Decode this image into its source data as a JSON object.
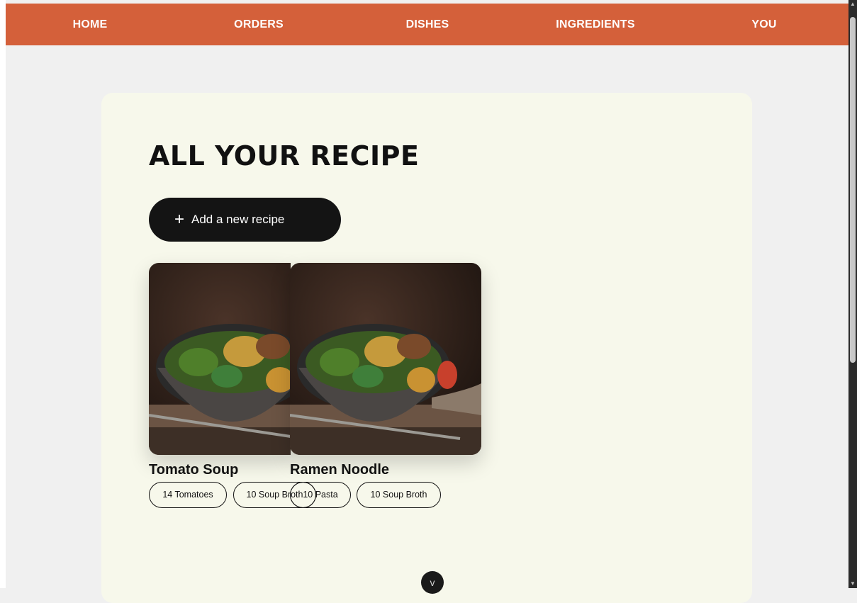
{
  "nav": {
    "items": [
      {
        "label": "HOME"
      },
      {
        "label": "ORDERS"
      },
      {
        "label": "DISHES"
      },
      {
        "label": "INGREDIENTS"
      },
      {
        "label": "YOU"
      }
    ]
  },
  "main": {
    "title": "ALL YOUR RECIPE",
    "add_button": {
      "icon": "plus-icon",
      "label": "Add a new recipe"
    },
    "recipes": [
      {
        "name": "Tomato Soup",
        "image": "salad-bowl-photo",
        "tags": [
          "14 Tomatoes",
          "10 Soup Broth"
        ]
      },
      {
        "name": "Ramen Noodle",
        "image": "salad-bowl-photo",
        "tags": [
          "10 Pasta",
          "10 Soup Broth"
        ]
      }
    ],
    "scroll_down_icon": "chevron-down-icon"
  },
  "colors": {
    "nav": "#d4603a",
    "panel": "#f7f8eb",
    "background": "#f0f0f0",
    "button": "#141414"
  }
}
